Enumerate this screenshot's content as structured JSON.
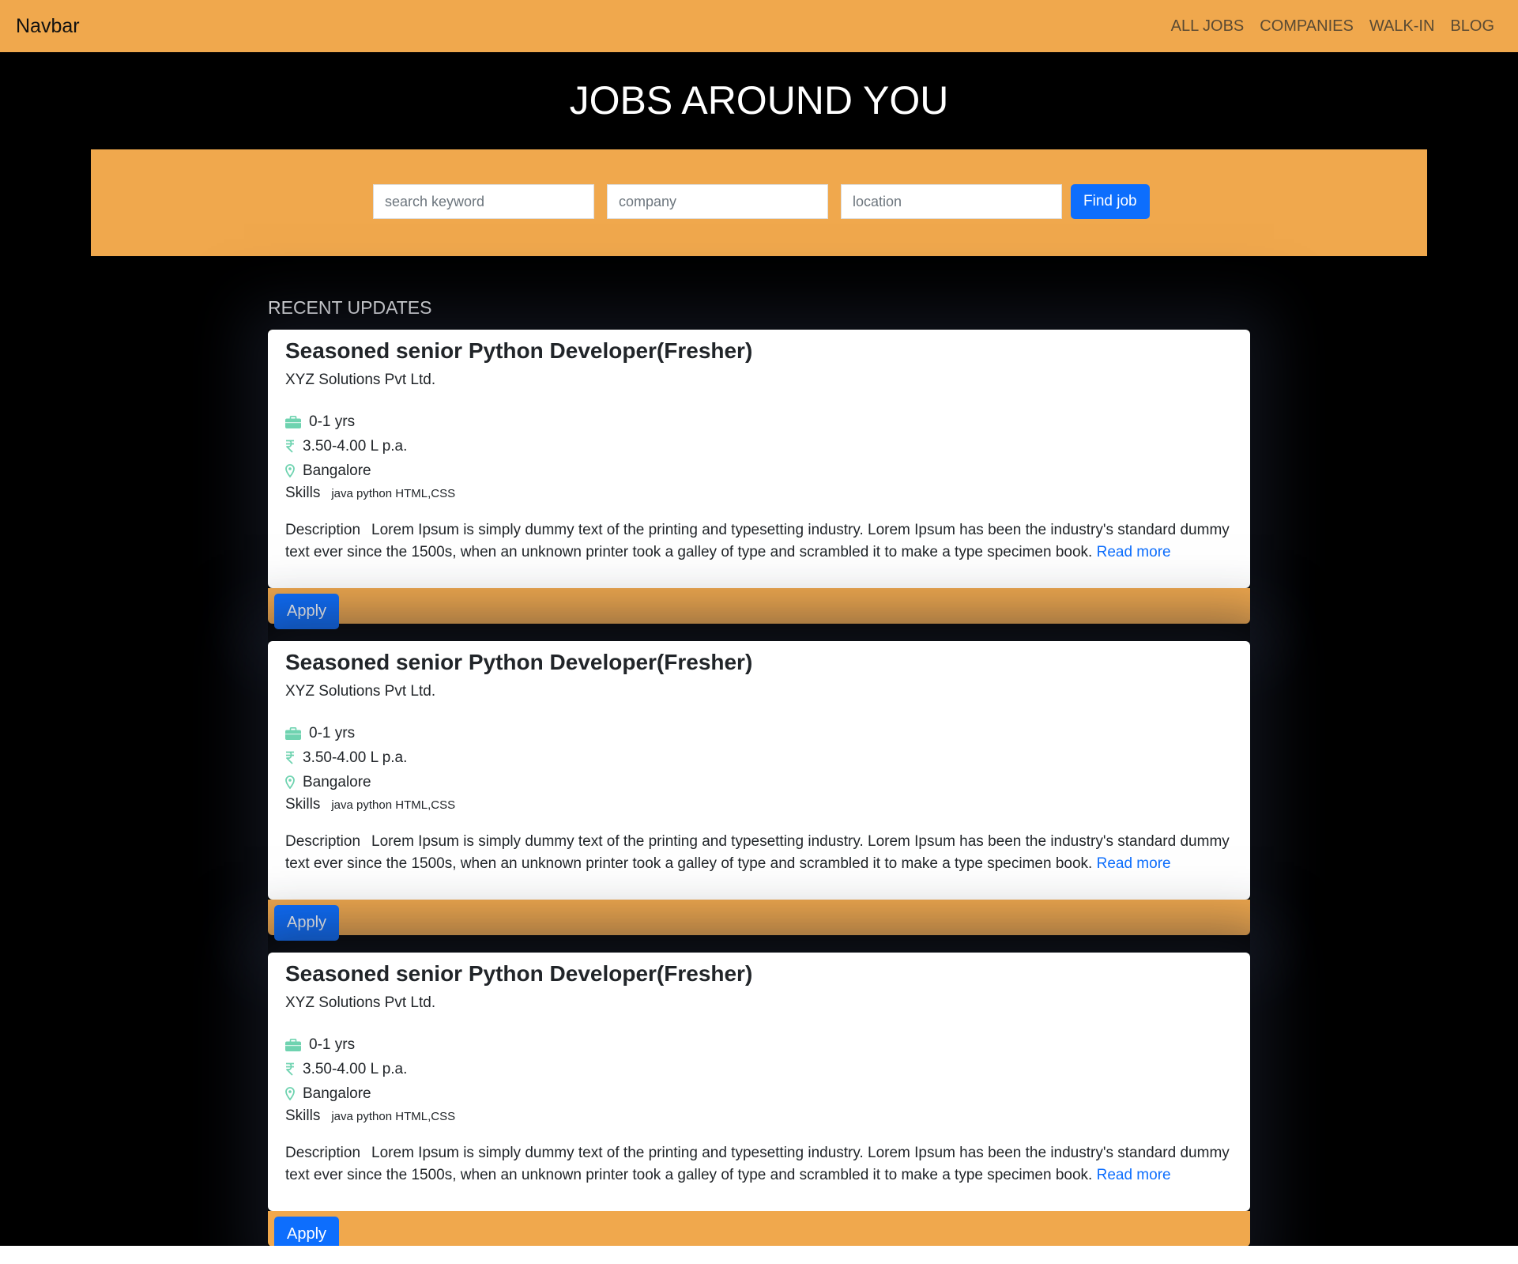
{
  "navbar": {
    "brand": "Navbar",
    "links": [
      "ALL JOBS",
      "COMPANIES",
      "WALK-IN",
      "BLOG"
    ]
  },
  "hero": {
    "title": "JOBS AROUND YOU"
  },
  "search": {
    "keyword_placeholder": "search keyword",
    "company_placeholder": "company",
    "location_placeholder": "location",
    "button_label": "Find job"
  },
  "recent": {
    "heading": "RECENT UPDATES",
    "jobs": [
      {
        "title": "Seasoned senior Python Developer(Fresher)",
        "company": "XYZ Solutions Pvt Ltd.",
        "experience": "0-1 yrs",
        "salary": "3.50-4.00 L p.a.",
        "location": "Bangalore",
        "skills_label": "Skills",
        "skills": "java python HTML,CSS",
        "description_label": "Description",
        "description": "Lorem Ipsum is simply dummy text of the printing and typesetting industry. Lorem Ipsum has been the industry's standard dummy text ever since the 1500s, when an unknown printer took a galley of type and scrambled it to make a type specimen book.",
        "read_more": "Read more",
        "apply_label": "Apply"
      },
      {
        "title": "Seasoned senior Python Developer(Fresher)",
        "company": "XYZ Solutions Pvt Ltd.",
        "experience": "0-1 yrs",
        "salary": "3.50-4.00 L p.a.",
        "location": "Bangalore",
        "skills_label": "Skills",
        "skills": "java python HTML,CSS",
        "description_label": "Description",
        "description": "Lorem Ipsum is simply dummy text of the printing and typesetting industry. Lorem Ipsum has been the industry's standard dummy text ever since the 1500s, when an unknown printer took a galley of type and scrambled it to make a type specimen book.",
        "read_more": "Read more",
        "apply_label": "Apply"
      },
      {
        "title": "Seasoned senior Python Developer(Fresher)",
        "company": "XYZ Solutions Pvt Ltd.",
        "experience": "0-1 yrs",
        "salary": "3.50-4.00 L p.a.",
        "location": "Bangalore",
        "skills_label": "Skills",
        "skills": "java python HTML,CSS",
        "description_label": "Description",
        "description": "Lorem Ipsum is simply dummy text of the printing and typesetting industry. Lorem Ipsum has been the industry's standard dummy text ever since the 1500s, when an unknown printer took a galley of type and scrambled it to make a type specimen book.",
        "read_more": "Read more",
        "apply_label": "Apply"
      }
    ]
  },
  "icons": {
    "experience": "briefcase-icon",
    "salary": "rupee-icon",
    "location": "map-pin-icon"
  },
  "colors": {
    "accent": "#f0a84d",
    "primary": "#0d6efd",
    "icon": "#6fd3b0",
    "background": "#000000"
  }
}
